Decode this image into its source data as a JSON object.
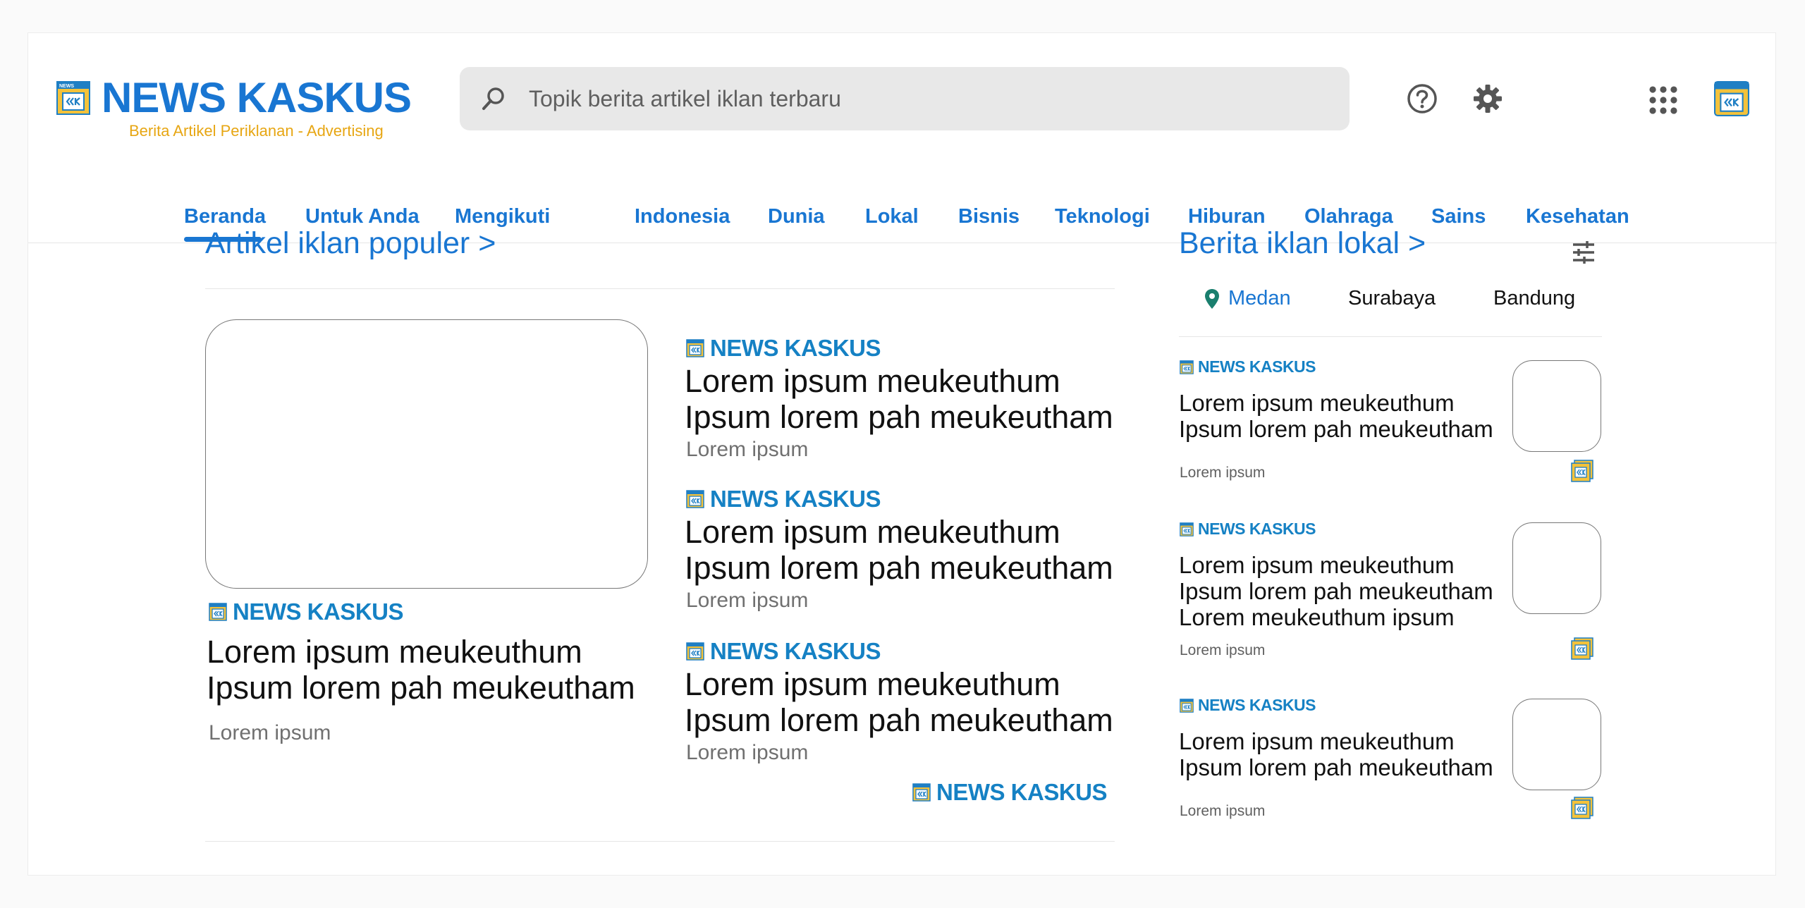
{
  "brand": {
    "name": "NEWS KASKUS",
    "tagline": "Berita Artikel Periklanan - Advertising",
    "icon_abbr": "NEWS",
    "colors": {
      "primary": "#1976d2",
      "accent": "#e7a613",
      "source": "#1581c4"
    }
  },
  "search": {
    "placeholder": "Topik berita artikel iklan terbaru",
    "icon": "search-icon"
  },
  "header_icons": [
    "help-icon",
    "gear-icon",
    "apps-icon",
    "profile-icon"
  ],
  "nav": {
    "active": "Beranda",
    "items": [
      "Beranda",
      "Untuk Anda",
      "Mengikuti",
      "Indonesia",
      "Dunia",
      "Lokal",
      "Bisnis",
      "Teknologi",
      "Hiburan",
      "Olahraga",
      "Sains",
      "Kesehatan"
    ]
  },
  "popular": {
    "title": "Artikel iklan populer >",
    "featured": {
      "source": "NEWS KASKUS",
      "headline": [
        "Lorem ipsum meukeuthum",
        "Ipsum lorem pah meukeutham"
      ],
      "meta": "Lorem ipsum"
    },
    "articles": [
      {
        "source": "NEWS KASKUS",
        "headline": [
          "Lorem ipsum meukeuthum",
          "Ipsum lorem pah meukeutham"
        ],
        "meta": "Lorem ipsum"
      },
      {
        "source": "NEWS KASKUS",
        "headline": [
          "Lorem ipsum meukeuthum",
          "Ipsum lorem pah meukeutham"
        ],
        "meta": "Lorem ipsum"
      },
      {
        "source": "NEWS KASKUS",
        "headline": [
          "Lorem ipsum meukeuthum",
          "Ipsum lorem pah meukeutham"
        ],
        "meta": "Lorem ipsum"
      }
    ],
    "more_source": "NEWS KASKUS"
  },
  "local": {
    "title": "Berita iklan lokal >",
    "filter_icon": "filter-icon",
    "tabs": [
      "Medan",
      "Surabaya",
      "Bandung"
    ],
    "active_tab": "Medan",
    "articles": [
      {
        "source": "NEWS KASKUS",
        "headline": [
          "Lorem ipsum meukeuthum",
          "Ipsum lorem pah meukeutham"
        ],
        "meta": "Lorem ipsum"
      },
      {
        "source": "NEWS KASKUS",
        "headline": [
          "Lorem ipsum meukeuthum",
          "Ipsum lorem pah meukeutham",
          "Lorem meukeuthum ipsum"
        ],
        "meta": "Lorem ipsum"
      },
      {
        "source": "NEWS KASKUS",
        "headline": [
          "Lorem ipsum meukeuthum",
          "Ipsum lorem pah meukeutham"
        ],
        "meta": "Lorem ipsum"
      }
    ]
  }
}
